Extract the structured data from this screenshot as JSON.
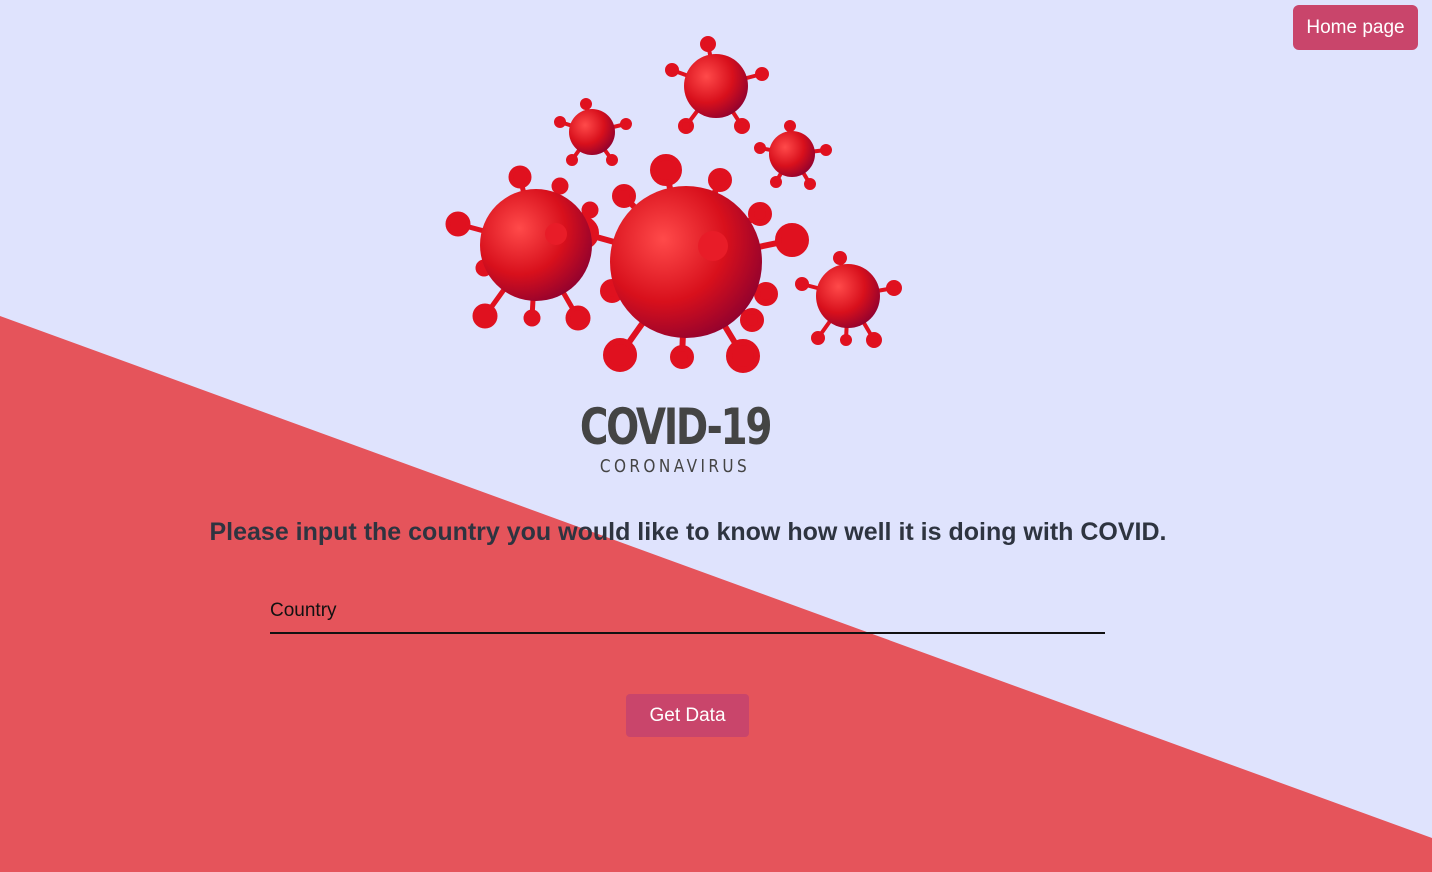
{
  "header": {
    "home_label": "Home page"
  },
  "logo": {
    "title": "COVID-19",
    "subtitle": "CORONAVIRUS",
    "icon": "virus-icon"
  },
  "form": {
    "prompt": "Please input the country you would like to know how well it is doing with COVID.",
    "country_placeholder": "Country",
    "country_value": "",
    "submit_label": "Get Data"
  },
  "colors": {
    "background": "#dfe3fd",
    "accent_wedge": "#e5545b",
    "button": "#c9456b",
    "virus": "#e0111f",
    "text": "#2e3440"
  }
}
